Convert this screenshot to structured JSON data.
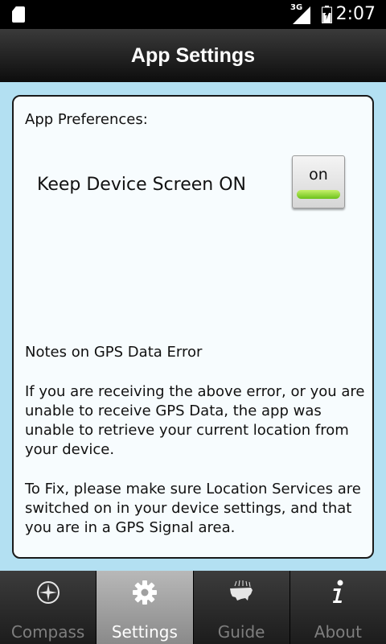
{
  "status_bar": {
    "network_type": "3G",
    "time": "2:07",
    "icons": [
      "sd-card-icon",
      "signal-icon",
      "battery-icon"
    ]
  },
  "header": {
    "title": "App Settings"
  },
  "preferences": {
    "section_label": "App Preferences:",
    "keep_screen_on": {
      "label": "Keep Device Screen ON",
      "button_text": "on",
      "state": true,
      "indicator_color": "#8ed83a"
    }
  },
  "notes": {
    "title": "Notes on GPS Data Error",
    "paragraph_1": "If you are receiving the above error, or you are unable to receive GPS Data, the app was unable to retrieve your current location from your device.",
    "paragraph_2": "To Fix, please make sure Location Services are switched on in your device settings, and that you are in a GPS Signal area."
  },
  "bottom_nav": {
    "tabs": [
      {
        "label": "Compass",
        "icon": "compass-icon",
        "active": false
      },
      {
        "label": "Settings",
        "icon": "gear-icon",
        "active": true
      },
      {
        "label": "Guide",
        "icon": "usa-map-icon",
        "active": false
      },
      {
        "label": "About",
        "icon": "info-icon",
        "active": false
      }
    ]
  },
  "colors": {
    "background": "#b3e0f2",
    "card": "#f7fcfe",
    "header": "#1a1a1a"
  }
}
